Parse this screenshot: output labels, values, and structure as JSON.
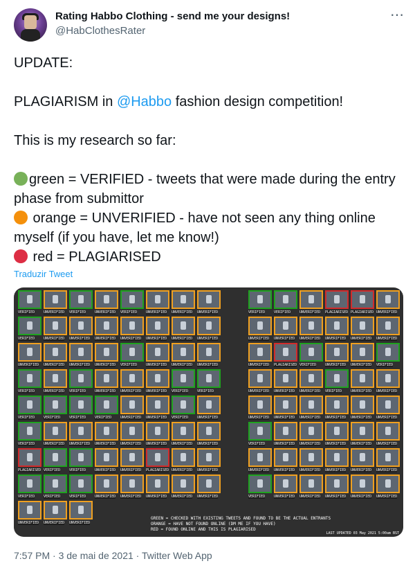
{
  "author": {
    "name": "Rating Habbo Clothing - send me your designs!",
    "handle": "@HabClothesRater"
  },
  "more_icon": "⋯",
  "tweet": {
    "update": "UPDATE:",
    "line2_pre": "PLAGIARISM in ",
    "mention": "@Habbo",
    "line2_post": " fashion design competition!",
    "research": "This is my research so far:",
    "legend": [
      {
        "color": "#78b159",
        "text": "green = VERIFIED - tweets that were made during the entry phase from submittor"
      },
      {
        "color": "#f4900c",
        "text": " orange = UNVERIFIED - have not seen any thing online myself (if you have, let me know!)"
      },
      {
        "color": "#dd2e44",
        "text": " red = PLAGIARISED"
      }
    ]
  },
  "translate_label": "Traduzir Tweet",
  "media": {
    "legend_lines": [
      "GREEN = CHECKED WITH EXISTING TWEETS AND FOUND TO BE THE ACTUAL ENTRANTS",
      "ORANGE = HAVE NOT FOUND ONLINE (DM ME IF YOU HAVE)",
      "RED = FOUND ONLINE AND THIS IS PLAGIARISED"
    ],
    "updated": "LAST UPDATED 03 May 2021 5:00am BST",
    "colors": {
      "green": "#1fa31f",
      "orange": "#f0a020",
      "red": "#d22b2b"
    },
    "cell_labels": {
      "green": "VERIFIED",
      "orange": "UNVERIFIED",
      "red": "PLAGIARISED"
    }
  },
  "footer": {
    "time": "7:57 PM",
    "date": "3 de mai de 2021",
    "source": "Twitter Web App"
  }
}
